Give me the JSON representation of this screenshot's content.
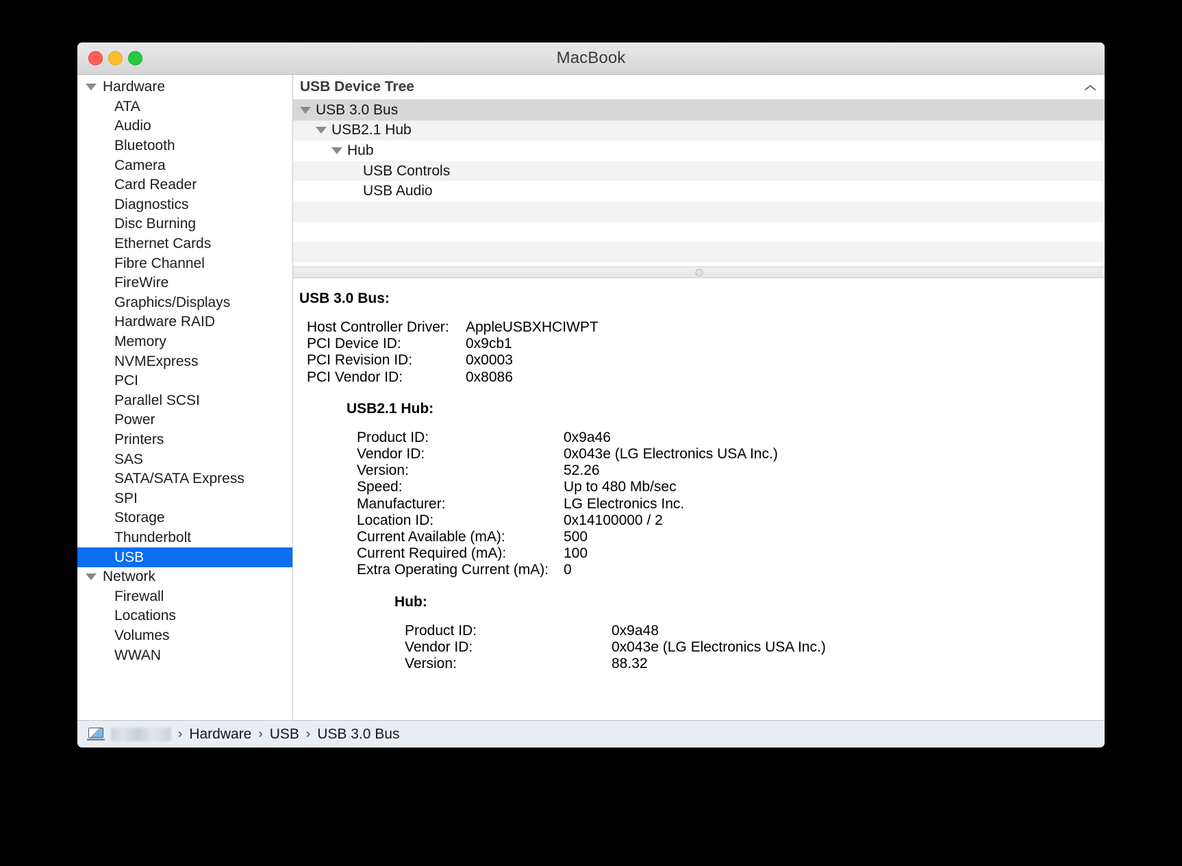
{
  "window": {
    "title": "MacBook",
    "controls": {
      "close": "close",
      "minimize": "minimize",
      "zoom": "zoom"
    }
  },
  "sidebar": {
    "items": [
      {
        "label": "Hardware",
        "level": "group",
        "expanded": true,
        "selected": false
      },
      {
        "label": "ATA",
        "level": "child",
        "selected": false
      },
      {
        "label": "Audio",
        "level": "child",
        "selected": false
      },
      {
        "label": "Bluetooth",
        "level": "child",
        "selected": false
      },
      {
        "label": "Camera",
        "level": "child",
        "selected": false
      },
      {
        "label": "Card Reader",
        "level": "child",
        "selected": false
      },
      {
        "label": "Diagnostics",
        "level": "child",
        "selected": false
      },
      {
        "label": "Disc Burning",
        "level": "child",
        "selected": false
      },
      {
        "label": "Ethernet Cards",
        "level": "child",
        "selected": false
      },
      {
        "label": "Fibre Channel",
        "level": "child",
        "selected": false
      },
      {
        "label": "FireWire",
        "level": "child",
        "selected": false
      },
      {
        "label": "Graphics/Displays",
        "level": "child",
        "selected": false
      },
      {
        "label": "Hardware RAID",
        "level": "child",
        "selected": false
      },
      {
        "label": "Memory",
        "level": "child",
        "selected": false
      },
      {
        "label": "NVMExpress",
        "level": "child",
        "selected": false
      },
      {
        "label": "PCI",
        "level": "child",
        "selected": false
      },
      {
        "label": "Parallel SCSI",
        "level": "child",
        "selected": false
      },
      {
        "label": "Power",
        "level": "child",
        "selected": false
      },
      {
        "label": "Printers",
        "level": "child",
        "selected": false
      },
      {
        "label": "SAS",
        "level": "child",
        "selected": false
      },
      {
        "label": "SATA/SATA Express",
        "level": "child",
        "selected": false
      },
      {
        "label": "SPI",
        "level": "child",
        "selected": false
      },
      {
        "label": "Storage",
        "level": "child",
        "selected": false
      },
      {
        "label": "Thunderbolt",
        "level": "child",
        "selected": false
      },
      {
        "label": "USB",
        "level": "child",
        "selected": true
      },
      {
        "label": "Network",
        "level": "group",
        "expanded": true,
        "selected": false
      },
      {
        "label": "Firewall",
        "level": "child",
        "selected": false
      },
      {
        "label": "Locations",
        "level": "child",
        "selected": false
      },
      {
        "label": "Volumes",
        "level": "child",
        "selected": false
      },
      {
        "label": "WWAN",
        "level": "child",
        "selected": false
      }
    ]
  },
  "tree_panel": {
    "header": "USB Device Tree",
    "collapse_icon": "chevron-up-icon",
    "rows": [
      {
        "label": "USB 3.0 Bus",
        "indent": 0,
        "expanded": true,
        "selected": true
      },
      {
        "label": "USB2.1 Hub",
        "indent": 1,
        "expanded": true,
        "selected": false
      },
      {
        "label": "Hub",
        "indent": 2,
        "expanded": true,
        "selected": false
      },
      {
        "label": "USB Controls",
        "indent": 3,
        "expanded": null,
        "selected": false
      },
      {
        "label": "USB Audio",
        "indent": 3,
        "expanded": null,
        "selected": false
      },
      {
        "label": "",
        "indent": 0,
        "expanded": null,
        "selected": false
      },
      {
        "label": "",
        "indent": 0,
        "expanded": null,
        "selected": false
      },
      {
        "label": "",
        "indent": 0,
        "expanded": null,
        "selected": false
      }
    ]
  },
  "detail_panel": {
    "bus": {
      "title": "USB 3.0 Bus:",
      "rows": [
        {
          "key": "Host Controller Driver:",
          "value": "AppleUSBXHCIWPT"
        },
        {
          "key": "PCI Device ID:",
          "value": "0x9cb1"
        },
        {
          "key": "PCI Revision ID:",
          "value": "0x0003"
        },
        {
          "key": "PCI Vendor ID:",
          "value": "0x8086"
        }
      ]
    },
    "usb21hub": {
      "title": "USB2.1 Hub:",
      "rows": [
        {
          "key": "Product ID:",
          "value": "0x9a46"
        },
        {
          "key": "Vendor ID:",
          "value": "0x043e  (LG Electronics USA Inc.)"
        },
        {
          "key": "Version:",
          "value": "52.26"
        },
        {
          "key": "Speed:",
          "value": "Up to 480 Mb/sec"
        },
        {
          "key": "Manufacturer:",
          "value": "LG Electronics Inc."
        },
        {
          "key": "Location ID:",
          "value": "0x14100000 / 2"
        },
        {
          "key": "Current Available (mA):",
          "value": "500"
        },
        {
          "key": "Current Required (mA):",
          "value": "100"
        },
        {
          "key": "Extra Operating Current (mA):",
          "value": "0"
        }
      ]
    },
    "hub": {
      "title": "Hub:",
      "rows": [
        {
          "key": "Product ID:",
          "value": "0x9a48"
        },
        {
          "key": "Vendor ID:",
          "value": "0x043e  (LG Electronics USA Inc.)"
        },
        {
          "key": "Version:",
          "value": "88.32"
        }
      ]
    }
  },
  "statusbar": {
    "device_icon": "macbook-icon",
    "device_name_redacted": "",
    "separator": "›",
    "crumbs": [
      "Hardware",
      "USB",
      "USB 3.0 Bus"
    ]
  }
}
